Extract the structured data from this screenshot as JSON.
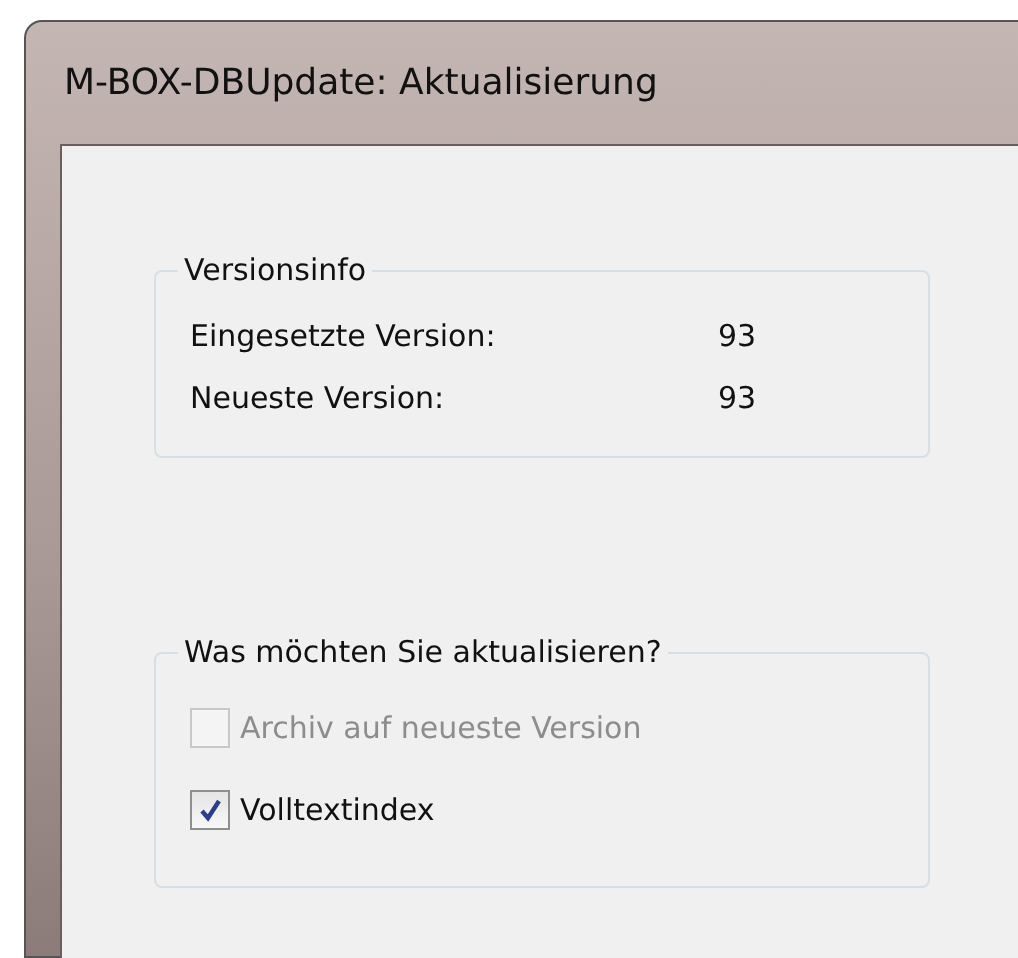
{
  "window": {
    "title": "M-BOX-DBUpdate: Aktualisierung"
  },
  "version_group": {
    "title": "Versionsinfo",
    "rows": [
      {
        "label": "Eingesetzte Version:",
        "value": "93"
      },
      {
        "label": "Neueste Version:",
        "value": "93"
      }
    ]
  },
  "update_group": {
    "title": "Was möchten Sie aktualisieren?",
    "options": [
      {
        "label": "Archiv auf neueste Version",
        "checked": false,
        "disabled": true
      },
      {
        "label": "Volltextindex",
        "checked": true,
        "disabled": false
      }
    ]
  }
}
